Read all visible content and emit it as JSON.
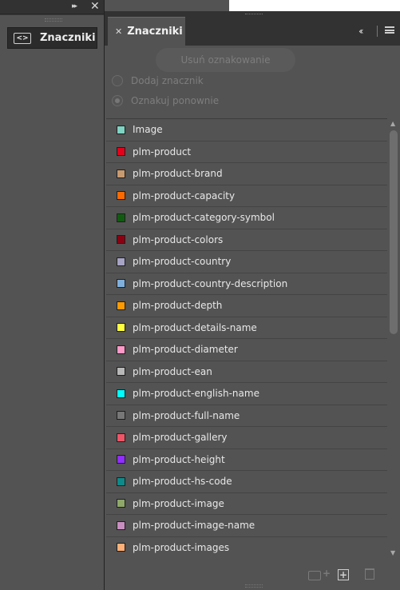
{
  "mini_dock": {
    "expand_icon": "double-chevron-right",
    "close_icon": "close-x",
    "button_label": "Znaczniki",
    "button_icon": "tag-brackets"
  },
  "panel": {
    "tab_label": "Znaczniki",
    "collapse_icon": "double-chevron-left",
    "menu_icon": "hamburger-menu"
  },
  "controls": {
    "untag_button": "Usuń oznakowanie",
    "radio_add_tag": "Dodaj znacznik",
    "radio_retag": "Oznakuj ponownie",
    "radio_selected": "Oznakuj ponownie"
  },
  "tags": [
    {
      "label": "Image",
      "color": "#7fd3c3"
    },
    {
      "label": "plm-product",
      "color": "#e3001b"
    },
    {
      "label": "plm-product-brand",
      "color": "#c89a6f"
    },
    {
      "label": "plm-product-capacity",
      "color": "#ff6a00"
    },
    {
      "label": "plm-product-category-symbol",
      "color": "#115b11"
    },
    {
      "label": "plm-product-colors",
      "color": "#8a0012"
    },
    {
      "label": "plm-product-country",
      "color": "#a6a3c4"
    },
    {
      "label": "plm-product-country-description",
      "color": "#7fb0dd"
    },
    {
      "label": "plm-product-depth",
      "color": "#ff9b00"
    },
    {
      "label": "plm-product-details-name",
      "color": "#ffff40"
    },
    {
      "label": "plm-product-diameter",
      "color": "#ff99c8"
    },
    {
      "label": "plm-product-ean",
      "color": "#b8b8b8"
    },
    {
      "label": "plm-product-english-name",
      "color": "#00ffff"
    },
    {
      "label": "plm-product-full-name",
      "color": "#777777"
    },
    {
      "label": "plm-product-gallery",
      "color": "#ee5566"
    },
    {
      "label": "plm-product-height",
      "color": "#8f2eff"
    },
    {
      "label": "plm-product-hs-code",
      "color": "#0f8a8a"
    },
    {
      "label": "plm-product-image",
      "color": "#8fa86a"
    },
    {
      "label": "plm-product-image-name",
      "color": "#c98ec0"
    },
    {
      "label": "plm-product-images",
      "color": "#ffb078"
    }
  ],
  "footer": {
    "new_tag_icon": "new-tag-plus",
    "add_icon": "add-square",
    "delete_icon": "trash-can"
  }
}
